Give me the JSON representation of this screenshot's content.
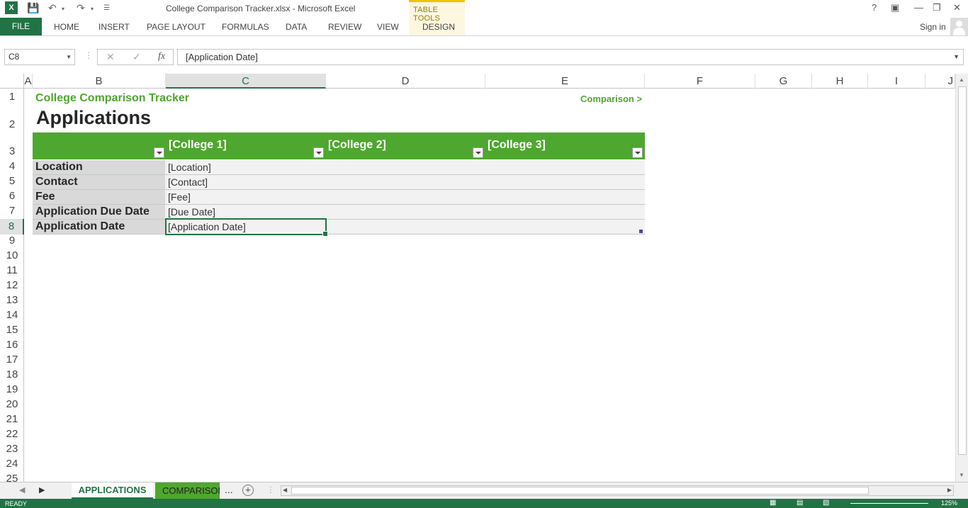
{
  "window": {
    "title": "College Comparison Tracker.xlsx - Microsoft Excel",
    "contextual_group": "TABLE TOOLS",
    "help": "?",
    "signin": "Sign in"
  },
  "ribbon": {
    "file": "FILE",
    "tabs": [
      "HOME",
      "INSERT",
      "PAGE LAYOUT",
      "FORMULAS",
      "DATA",
      "REVIEW",
      "VIEW",
      "DESIGN"
    ]
  },
  "formula_bar": {
    "name_box": "C8",
    "fx": "fx",
    "value": "[Application Date]"
  },
  "columns": [
    "A",
    "B",
    "C",
    "D",
    "E",
    "F",
    "G",
    "H",
    "I",
    "J"
  ],
  "rows": [
    "1",
    "2",
    "3",
    "4",
    "5",
    "6",
    "7",
    "8",
    "9",
    "10",
    "11",
    "12",
    "13",
    "14",
    "15",
    "16",
    "17",
    "18",
    "19",
    "20",
    "21",
    "22",
    "23",
    "24",
    "25"
  ],
  "sheet": {
    "title": "College Comparison Tracker",
    "nav_link": "Comparison >",
    "heading": "Applications",
    "table_headers": [
      "[College 1]",
      "[College 2]",
      "[College 3]"
    ],
    "table_rows": [
      {
        "label": "Location",
        "value": "[Location]"
      },
      {
        "label": "Contact",
        "value": "[Contact]"
      },
      {
        "label": "Fee",
        "value": "[Fee]"
      },
      {
        "label": "Application Due Date",
        "value": "[Due Date]"
      },
      {
        "label": "Application Date",
        "value": "[Application Date]"
      }
    ]
  },
  "sheet_tabs": {
    "active": "APPLICATIONS",
    "other": "COMPARISON",
    "more": "...",
    "add": "+"
  },
  "status": {
    "state": "READY",
    "zoom": "125%"
  },
  "colors": {
    "excel_green": "#217346",
    "table_green": "#4ea72e"
  }
}
